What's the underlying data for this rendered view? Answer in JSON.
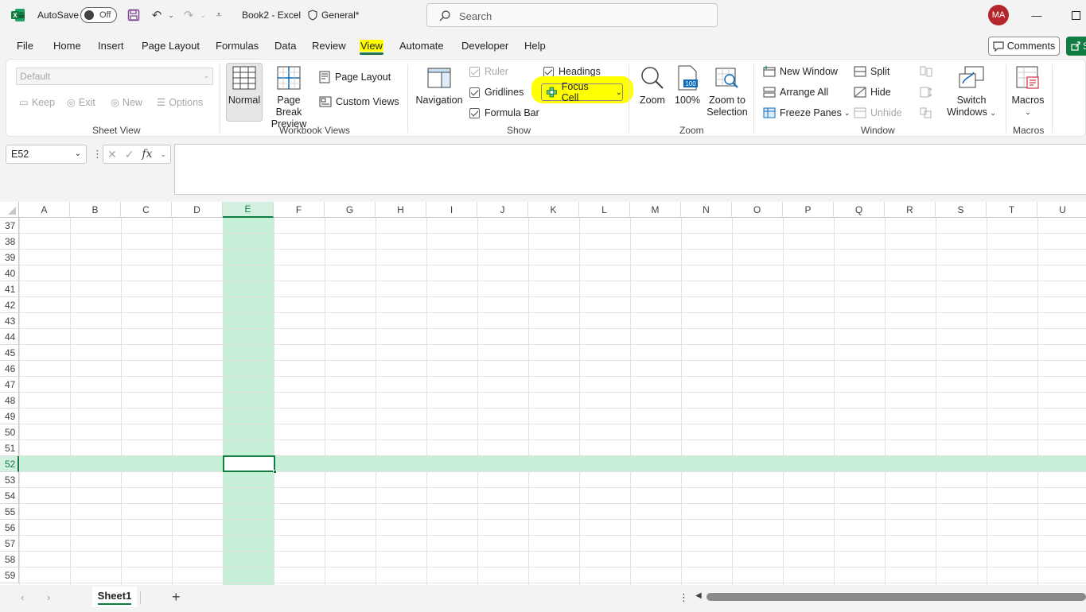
{
  "titlebar": {
    "autosave_label": "AutoSave",
    "autosave_state": "Off",
    "doc_title": "Book2  -  Excel",
    "sensitivity": "General*",
    "search_placeholder": "Search",
    "avatar_initials": "MA"
  },
  "menu": {
    "tabs": [
      "File",
      "Home",
      "Insert",
      "Page Layout",
      "Formulas",
      "Data",
      "Review",
      "View",
      "Automate",
      "Developer",
      "Help"
    ],
    "active_tab": "View",
    "comments_label": "Comments",
    "share_label": "S"
  },
  "ribbon": {
    "sheet_view": {
      "dropdown_value": "Default",
      "keep": "Keep",
      "exit": "Exit",
      "new": "New",
      "options": "Options",
      "label": "Sheet View"
    },
    "workbook_views": {
      "normal": "Normal",
      "page_break_1": "Page Break",
      "page_break_2": "Preview",
      "page_layout": "Page Layout",
      "custom_views": "Custom Views",
      "label": "Workbook Views"
    },
    "show": {
      "navigation": "Navigation",
      "ruler": "Ruler",
      "gridlines": "Gridlines",
      "formula_bar": "Formula Bar",
      "headings": "Headings",
      "focus_cell": "Focus Cell",
      "label": "Show"
    },
    "zoom": {
      "zoom": "Zoom",
      "hundred": "100%",
      "zoom_sel_1": "Zoom to",
      "zoom_sel_2": "Selection",
      "label": "Zoom"
    },
    "window": {
      "new_window": "New Window",
      "arrange_all": "Arrange All",
      "freeze_panes": "Freeze Panes",
      "split": "Split",
      "hide": "Hide",
      "unhide": "Unhide",
      "switch_1": "Switch",
      "switch_2": "Windows",
      "label": "Window"
    },
    "macros": {
      "macros": "Macros",
      "label": "Macros"
    }
  },
  "formula_bar": {
    "name_box": "E52",
    "formula": ""
  },
  "grid": {
    "columns": [
      "A",
      "B",
      "C",
      "D",
      "E",
      "F",
      "G",
      "H",
      "I",
      "J",
      "K",
      "L",
      "M",
      "N",
      "O",
      "P",
      "Q",
      "R",
      "S",
      "T",
      "U"
    ],
    "rows": [
      "37",
      "38",
      "39",
      "40",
      "41",
      "42",
      "43",
      "44",
      "45",
      "46",
      "47",
      "48",
      "49",
      "50",
      "51",
      "52",
      "53",
      "54",
      "55",
      "56",
      "57",
      "58",
      "59"
    ],
    "selected_column": "E",
    "selected_row": "52"
  },
  "sheets": {
    "tabs": [
      "Sheet1"
    ],
    "active": "Sheet1"
  },
  "colors": {
    "accent": "#107c41",
    "focus_fill": "#c6efd8",
    "highlight": "#ffff00"
  }
}
